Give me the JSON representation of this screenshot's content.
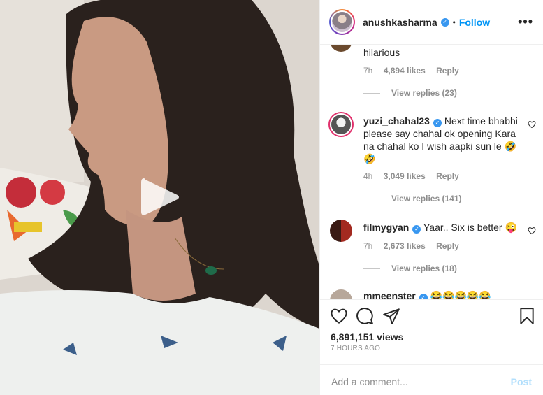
{
  "post": {
    "username": "anushkasharma",
    "separator": "•",
    "follow_label": "Follow",
    "more_label": "•••"
  },
  "comments": [
    {
      "username": "",
      "text": "hilarious",
      "time": "7h",
      "likes": "4,894 likes",
      "reply_label": "Reply",
      "view_replies": "View replies (23)"
    },
    {
      "username": "yuzi_chahal23",
      "text": "Next time bhabhi please say chahal ok opening Kara na chahal ko I wish aapki sun le 🤣🤣",
      "time": "4h",
      "likes": "3,049 likes",
      "reply_label": "Reply",
      "view_replies": "View replies (141)"
    },
    {
      "username": "filmygyan",
      "text": "Yaar.. Six is better 😜",
      "time": "7h",
      "likes": "2,673 likes",
      "reply_label": "Reply",
      "view_replies": "View replies (18)"
    },
    {
      "username": "mmeenster",
      "text": "😂😂😂😂😂"
    }
  ],
  "stats": {
    "views": "6,891,151 views",
    "time_ago": "7 HOURS AGO"
  },
  "comment_box": {
    "placeholder": "Add a comment...",
    "post_label": "Post"
  },
  "colors": {
    "accent": "#0095f6",
    "verified": "#3897f0",
    "muted": "#8e8e8e",
    "post_disabled": "#b2dffc"
  },
  "icons": [
    "play-icon",
    "verified-icon",
    "heart-icon",
    "comment-icon",
    "share-icon",
    "bookmark-icon"
  ]
}
